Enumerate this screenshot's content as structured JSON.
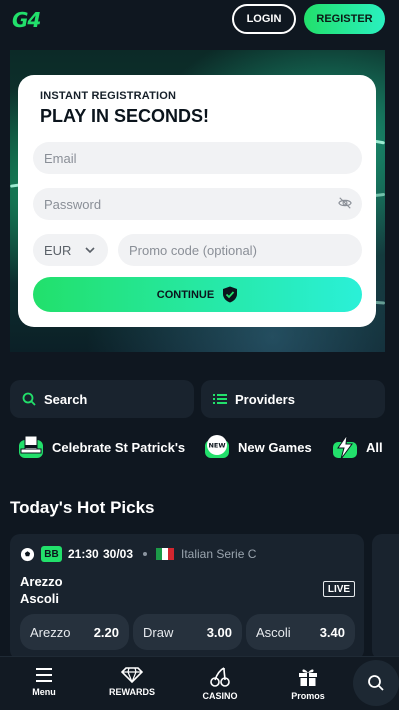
{
  "header": {
    "logo": "G4",
    "login_label": "LOGIN",
    "register_label": "REGISTER"
  },
  "registration": {
    "subtitle": "INSTANT REGISTRATION",
    "title": "PLAY IN SECONDS!",
    "email_placeholder": "Email",
    "password_placeholder": "Password",
    "currency": "EUR",
    "promo_placeholder": "Promo code (optional)",
    "continue_label": "CONTINUE"
  },
  "quick": {
    "search_label": "Search",
    "providers_label": "Providers"
  },
  "categories": [
    {
      "label": "Celebrate St Patrick's",
      "icon": "leprechaun-hat-icon"
    },
    {
      "label": "New Games",
      "icon": "new-badge-icon"
    },
    {
      "label": "All",
      "icon": "lightning-icon"
    }
  ],
  "hot_picks": {
    "title": "Today's Hot Picks",
    "match": {
      "badge": "BB",
      "time": "21:30",
      "date": "30/03",
      "league": "Italian Serie C",
      "home": "Arezzo",
      "away": "Ascoli",
      "status": "LIVE",
      "odds": [
        {
          "label": "Arezzo",
          "value": "2.20"
        },
        {
          "label": "Draw",
          "value": "3.00"
        },
        {
          "label": "Ascoli",
          "value": "3.40"
        }
      ]
    }
  },
  "bottom_nav": [
    {
      "label": "Menu",
      "icon": "hamburger-icon"
    },
    {
      "label": "REWARDS",
      "icon": "diamond-icon"
    },
    {
      "label": "CASINO",
      "icon": "cherries-icon"
    },
    {
      "label": "Promos",
      "icon": "gift-icon"
    }
  ],
  "colors": {
    "accent": "#22e06b",
    "accent_2": "#2af0d8",
    "background": "#0f1720",
    "card": "#19232e"
  }
}
